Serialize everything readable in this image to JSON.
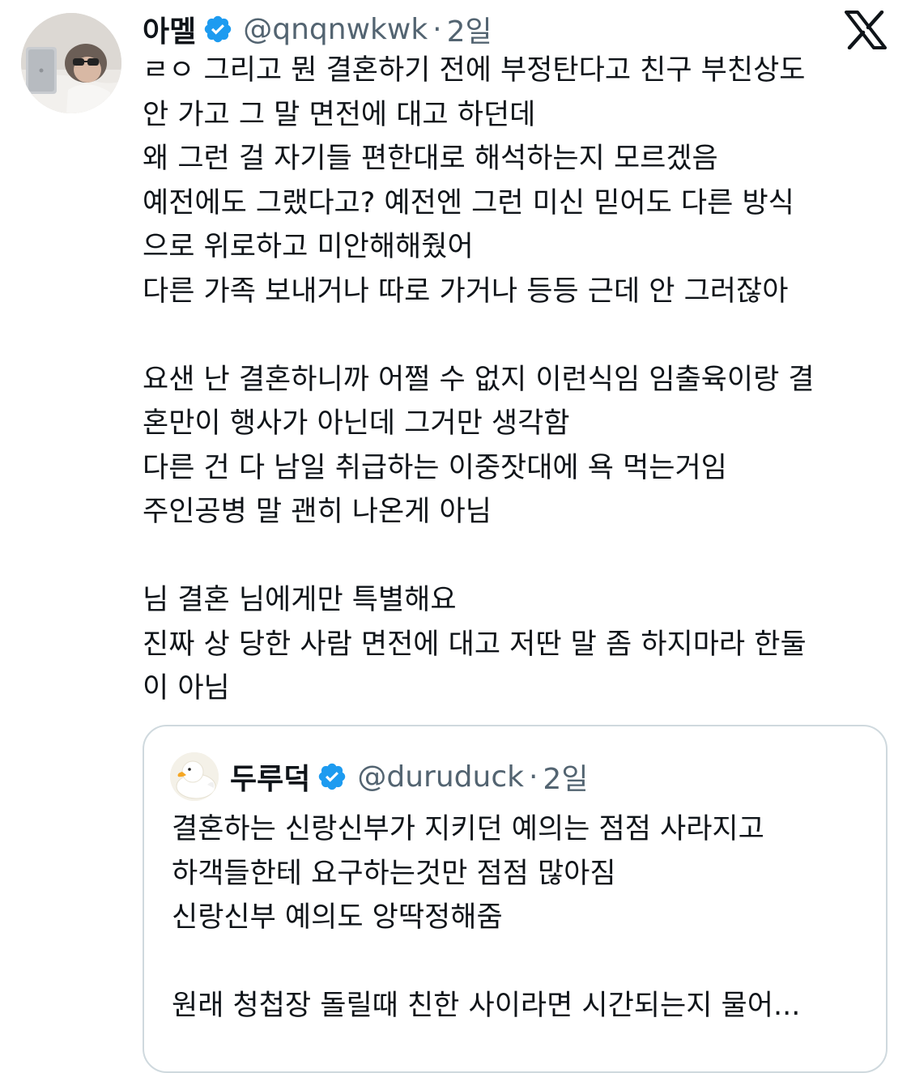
{
  "tweet": {
    "author_name": "아멜",
    "author_handle": "@qnqnwkwk",
    "separator": "·",
    "time": "2일",
    "verified_icon": "verified-badge-icon",
    "platform_icon": "x-logo-icon",
    "lines": [
      "ㄹㅇ 그리고 뭔 결혼하기 전에 부정탄다고 친구 부친상도",
      "안 가고 그 말 면전에 대고 하던데",
      "왜 그런 걸 자기들 편한대로 해석하는지 모르겠음",
      "예전에도 그랬다고? 예전엔 그런 미신 믿어도 다른 방식",
      "으로 위로하고 미안해해줬어",
      "다른 가족 보내거나 따로 가거나 등등 근데 안 그러잖아",
      "",
      "요샌 난 결혼하니까 어쩔 수 없지 이런식임 임출육이랑 결",
      "혼만이 행사가 아닌데 그거만 생각함",
      "다른 건 다 남일 취급하는 이중잣대에 욕 먹는거임",
      "주인공병 말 괜히 나온게 아님",
      "",
      "님 결혼 님에게만 특별해요",
      "진짜 상 당한 사람 면전에 대고 저딴 말 좀 하지마라 한둘",
      "이 아님"
    ]
  },
  "quoted_tweet": {
    "author_name": "두루덕",
    "author_handle": "@duruduck",
    "separator": "·",
    "time": "2일",
    "lines": [
      "결혼하는 신랑신부가 지키던 예의는 점점 사라지고",
      "하객들한테 요구하는것만 점점 많아짐",
      "신랑신부 예의도 앙딱정해줌",
      "",
      "원래 청첩장 돌릴때 친한 사이라면 시간되는지 물어..."
    ]
  },
  "colors": {
    "text_primary": "#0f1419",
    "text_secondary": "#536471",
    "verified_blue": "#1d9bf0",
    "border": "#cfd9de"
  }
}
